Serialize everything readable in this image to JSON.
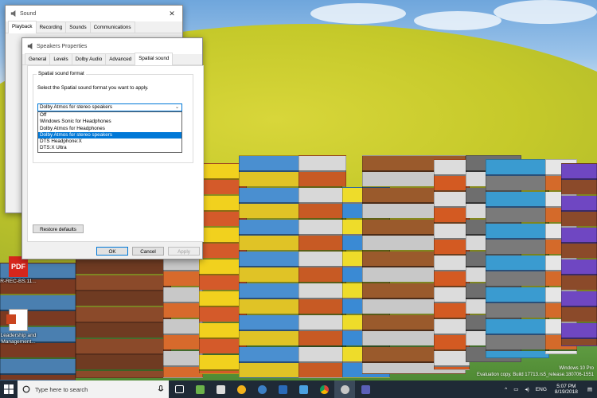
{
  "sound_dialog": {
    "title": "Sound",
    "tabs": [
      "Playback",
      "Recording",
      "Sounds",
      "Communications"
    ]
  },
  "speakers_dialog": {
    "title": "Speakers Properties",
    "tabs": [
      "General",
      "Levels",
      "Dolby Audio",
      "Advanced",
      "Spatial sound"
    ],
    "active_tab": "Spatial sound",
    "group_label": "Spatial sound format",
    "instruction": "Select the Spatial sound format you want to apply.",
    "selected_format": "Dolby Atmos for stereo speakers",
    "options": [
      "Off",
      "Windows Sonic for Headphones",
      "Dolby Atmos for Headphones",
      "Dolby Atmos for stereo speakers",
      "DTS Headphone:X",
      "DTS:X Ultra"
    ],
    "restore_defaults": "Restore defaults",
    "ok": "OK",
    "cancel": "Cancel",
    "apply": "Apply"
  },
  "desktop": {
    "icons": [
      {
        "label": "R-REC-BS.11...",
        "glyph": "PDF"
      },
      {
        "label": "Leadership and Management..."
      }
    ]
  },
  "taskbar": {
    "search_placeholder": "Type here to search",
    "language": "ENG",
    "time": "5:07 PM",
    "date": "8/19/2018"
  },
  "watermark": {
    "line1": "Windows 10 Pro",
    "line2": "Evaluation copy. Build 17713.rs5_release.180706-1551"
  },
  "colors": {
    "accent": "#0078d7",
    "taskbar": "#1f2a36"
  }
}
